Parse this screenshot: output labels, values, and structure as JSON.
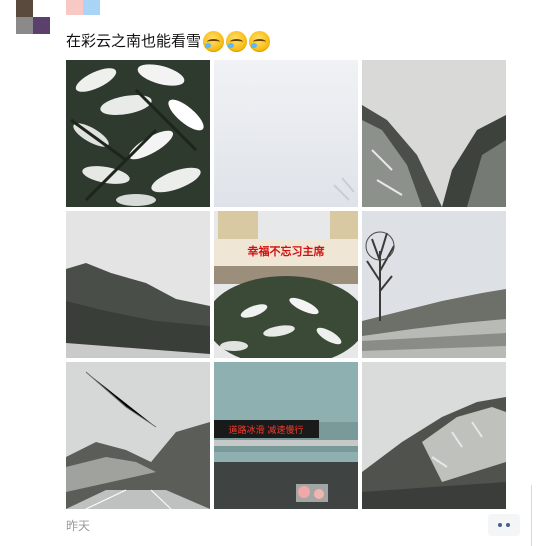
{
  "post": {
    "text": "在彩云之南也能看雪",
    "emoji_count": 3,
    "emoji_icon": "laughing-crying-face-icon",
    "timestamp": "昨天"
  },
  "photos": [
    {
      "description": "snow-covered-leaves-icon"
    },
    {
      "description": "snow-surface-icon"
    },
    {
      "description": "misty-mountain-valley-icon"
    },
    {
      "description": "foggy-mountain-ridge-icon"
    },
    {
      "description": "building-with-sign-icon"
    },
    {
      "description": "bare-tree-snowy-hill-icon"
    },
    {
      "description": "highway-mountains-icon"
    },
    {
      "description": "highway-led-sign-icon"
    },
    {
      "description": "snowy-slope-icon"
    }
  ],
  "photo5_sign": "幸福不忘习主席",
  "photo8_led": "道路冰滑 减速慢行",
  "colors": {
    "sign_red": "#d01010",
    "led_red": "#ff3a2a",
    "timestamp": "#9a9a9a",
    "more_dots": "#4a5f8a"
  }
}
